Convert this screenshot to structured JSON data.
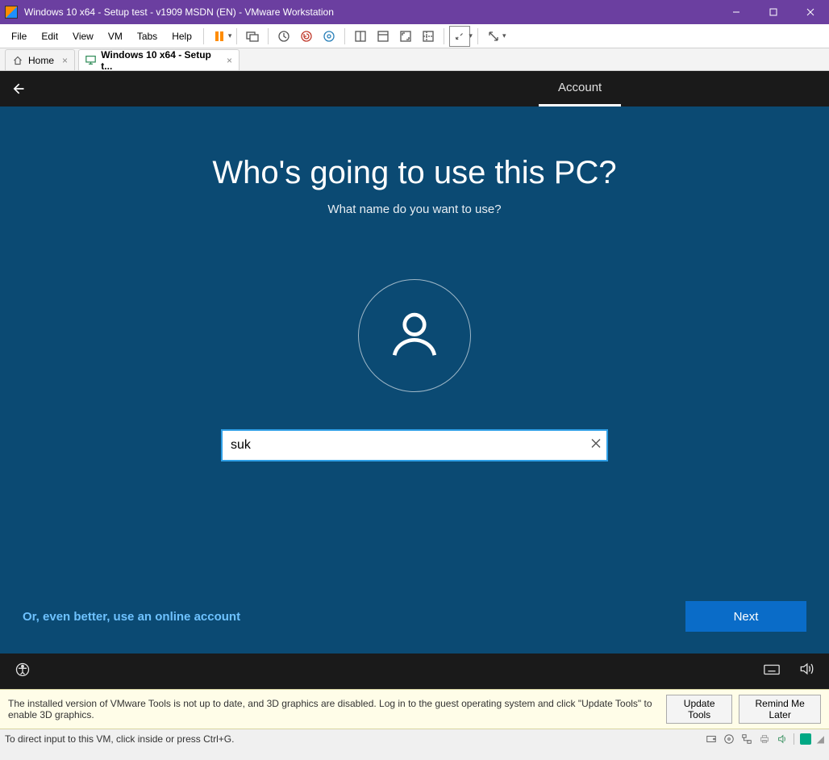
{
  "window": {
    "title": "Windows 10 x64 - Setup test - v1909 MSDN (EN) - VMware Workstation"
  },
  "menubar": {
    "items": [
      "File",
      "Edit",
      "View",
      "VM",
      "Tabs",
      "Help"
    ]
  },
  "tabs": [
    {
      "label": "Home",
      "active": false
    },
    {
      "label": "Windows 10 x64 - Setup t...",
      "active": true
    }
  ],
  "oobe": {
    "step_label": "Account",
    "heading": "Who's going to use this PC?",
    "subheading": "What name do you want to use?",
    "name_value": "suk",
    "online_link": "Or, even better, use an online account",
    "next_label": "Next"
  },
  "notice": {
    "text": "The installed version of VMware Tools is not up to date, and 3D graphics are disabled. Log in to the guest operating system and click \"Update Tools\" to enable 3D graphics.",
    "update_label": "Update Tools",
    "remind_label": "Remind Me Later"
  },
  "statusbar": {
    "hint": "To direct input to this VM, click inside or press Ctrl+G."
  }
}
